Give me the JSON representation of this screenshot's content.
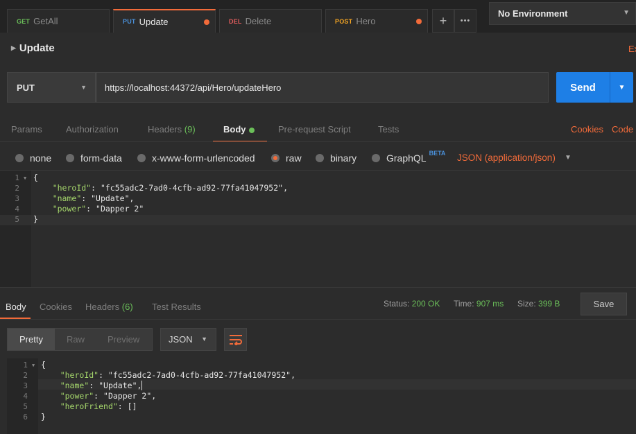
{
  "tabs": [
    {
      "method": "GET",
      "name": "GetAll",
      "active": false,
      "modified": false
    },
    {
      "method": "PUT",
      "name": "Update",
      "active": true,
      "modified": true
    },
    {
      "method": "DEL",
      "name": "Delete",
      "active": false,
      "modified": false
    },
    {
      "method": "POST",
      "name": "Hero",
      "active": false,
      "modified": true
    }
  ],
  "tab_actions": {
    "add": "+",
    "more": "•••"
  },
  "environment": {
    "selected": "No Environment"
  },
  "request": {
    "title": "Update",
    "right_cut_text": "Ex",
    "method": "PUT",
    "url": "https://localhost:44372/api/Hero/updateHero",
    "send_label": "Send"
  },
  "request_tabs": {
    "params": "Params",
    "authorization": "Authorization",
    "headers": "Headers",
    "headers_count": "(9)",
    "body": "Body",
    "prerequest": "Pre-request Script",
    "tests": "Tests",
    "cookies": "Cookies",
    "code": "Code"
  },
  "body_types": {
    "none": "none",
    "form_data": "form-data",
    "urlencoded": "x-www-form-urlencoded",
    "raw": "raw",
    "binary": "binary",
    "graphql": "GraphQL",
    "beta": "BETA",
    "selected": "raw",
    "content_type": "JSON (application/json)"
  },
  "request_body": {
    "line_numbers": [
      "1",
      "2",
      "3",
      "4",
      "5"
    ],
    "lines": [
      {
        "text": "{"
      },
      {
        "indent": "    ",
        "key": "\"heroId\"",
        "sep": ": ",
        "value": "\"fc55adc2-7ad0-4cfb-ad92-77fa41047952\"",
        "end": ","
      },
      {
        "indent": "    ",
        "key": "\"name\"",
        "sep": ": ",
        "value": "\"Update\"",
        "end": ","
      },
      {
        "indent": "    ",
        "key": "\"power\"",
        "sep": ": ",
        "value": "\"Dapper 2\"",
        "end": ""
      },
      {
        "text": "}"
      }
    ]
  },
  "response_tabs": {
    "body": "Body",
    "cookies": "Cookies",
    "headers": "Headers",
    "headers_count": "(6)",
    "test_results": "Test Results"
  },
  "response_meta": {
    "status_label": "Status:",
    "status_value": "200 OK",
    "time_label": "Time:",
    "time_value": "907 ms",
    "size_label": "Size:",
    "size_value": "399 B",
    "save_label": "Save"
  },
  "response_view": {
    "pretty": "Pretty",
    "raw": "Raw",
    "preview": "Preview",
    "format": "JSON"
  },
  "response_body": {
    "line_numbers": [
      "1",
      "2",
      "3",
      "4",
      "5",
      "6"
    ],
    "lines": [
      {
        "text": "{"
      },
      {
        "indent": "    ",
        "key": "\"heroId\"",
        "sep": ": ",
        "value": "\"fc55adc2-7ad0-4cfb-ad92-77fa41047952\"",
        "end": ","
      },
      {
        "indent": "    ",
        "key": "\"name\"",
        "sep": ": ",
        "value": "\"Update\"",
        "end": ","
      },
      {
        "indent": "    ",
        "key": "\"power\"",
        "sep": ": ",
        "value": "\"Dapper 2\"",
        "end": ","
      },
      {
        "indent": "    ",
        "key": "\"heroFriend\"",
        "sep": ": ",
        "value": "[]",
        "end": ""
      },
      {
        "text": "}"
      }
    ]
  },
  "colors": {
    "accent": "#f26b3a",
    "send_button": "#1e7fe6",
    "success": "#6bbf59",
    "json_key": "#a6d86c"
  }
}
